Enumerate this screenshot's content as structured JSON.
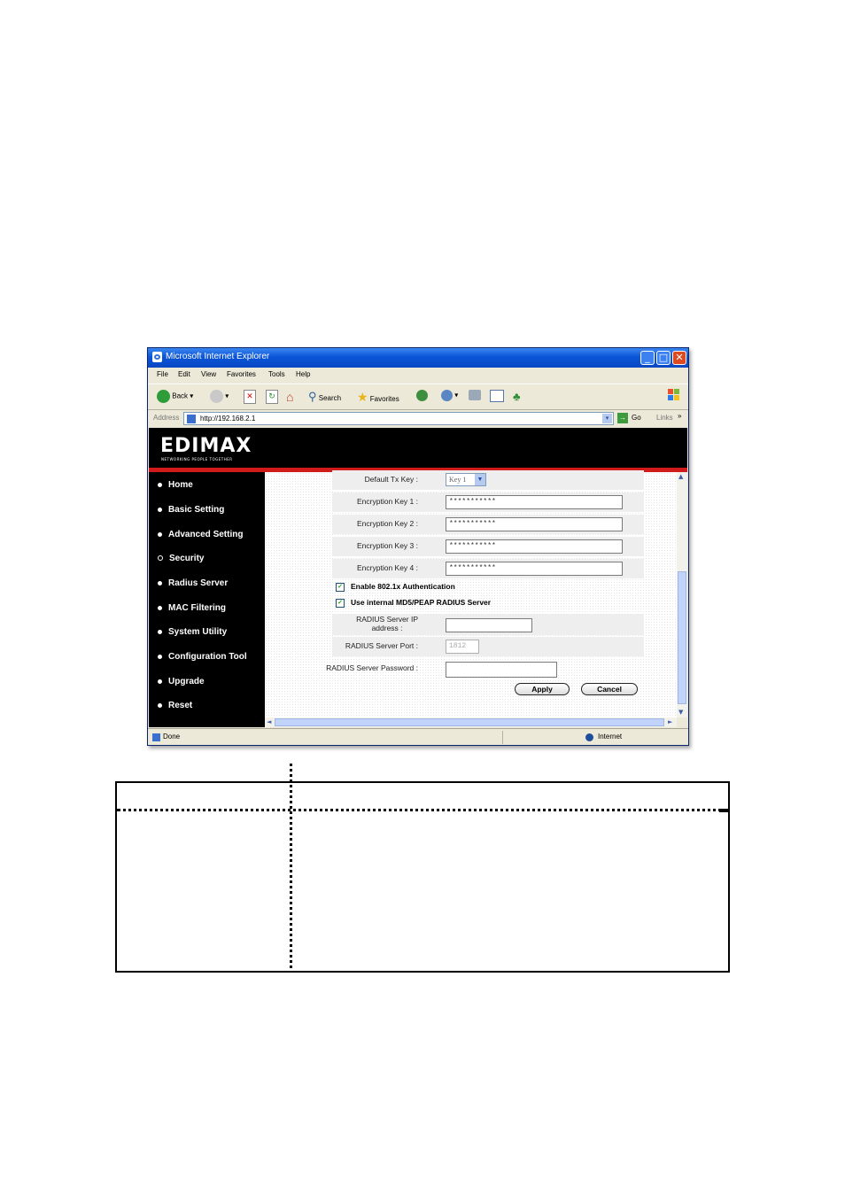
{
  "browser": {
    "title": "Microsoft Internet Explorer",
    "menu": [
      "File",
      "Edit",
      "View",
      "Favorites",
      "Tools",
      "Help"
    ],
    "toolbar": {
      "back_label": "Back",
      "search_label": "Search",
      "favorites_label": "Favorites"
    },
    "address_label": "Address",
    "address_value": "http://192.168.2.1",
    "go_label": "Go",
    "links_label": "Links",
    "status_left": "Done",
    "status_right": "Internet"
  },
  "brand": {
    "logo": "EDIMAX",
    "tagline": "NETWORKING PEOPLE TOGETHER"
  },
  "sidebar": {
    "items": [
      {
        "label": "Home"
      },
      {
        "label": "Basic Setting"
      },
      {
        "label": "Advanced Setting"
      },
      {
        "label": "Security"
      },
      {
        "label": "Radius Server"
      },
      {
        "label": "MAC Filtering"
      },
      {
        "label": "System Utility"
      },
      {
        "label": "Configuration Tool"
      },
      {
        "label": "Upgrade"
      },
      {
        "label": "Reset"
      }
    ]
  },
  "form": {
    "default_tx_key_label": "Default Tx Key :",
    "default_tx_key_value": "Key 1",
    "key1_label": "Encryption Key 1 :",
    "key1_value": "***********",
    "key2_label": "Encryption Key 2 :",
    "key2_value": "***********",
    "key3_label": "Encryption Key 3 :",
    "key3_value": "***********",
    "key4_label": "Encryption Key 4 :",
    "key4_value": "***********",
    "enable_8021x_label": "Enable 802.1x Authentication",
    "use_internal_label": "Use internal MD5/PEAP RADIUS Server",
    "radius_ip_label_line1": "RADIUS Server IP",
    "radius_ip_label_line2": "address :",
    "radius_ip_value": "",
    "radius_port_label": "RADIUS Server Port :",
    "radius_port_value": "1812",
    "radius_password_label": "RADIUS Server Password :",
    "radius_password_value": "",
    "apply_label": "Apply",
    "cancel_label": "Cancel"
  }
}
